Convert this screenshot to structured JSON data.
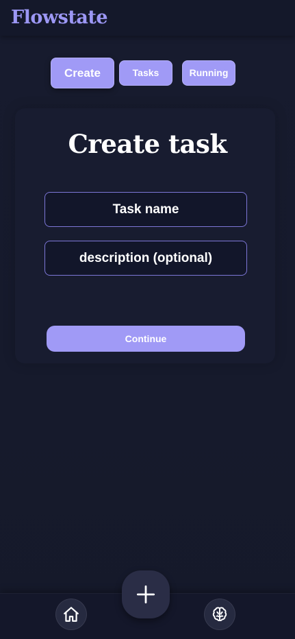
{
  "app": {
    "brand": "Flowstate"
  },
  "tabs": [
    {
      "label": "Create",
      "active": true
    },
    {
      "label": "Tasks",
      "active": false
    },
    {
      "label": "Running",
      "active": false
    }
  ],
  "form": {
    "title": "Create task",
    "task_name_placeholder": "Task name",
    "description_placeholder": "description (optional)",
    "continue_label": "Continue"
  },
  "bottom_nav": {
    "home_icon": "home-icon",
    "add_icon": "plus-icon",
    "brain_icon": "brain-icon"
  },
  "colors": {
    "accent": "#a09af6",
    "brand": "#9c97f4",
    "background": "#161a2c",
    "field_border": "#7d77d8"
  }
}
